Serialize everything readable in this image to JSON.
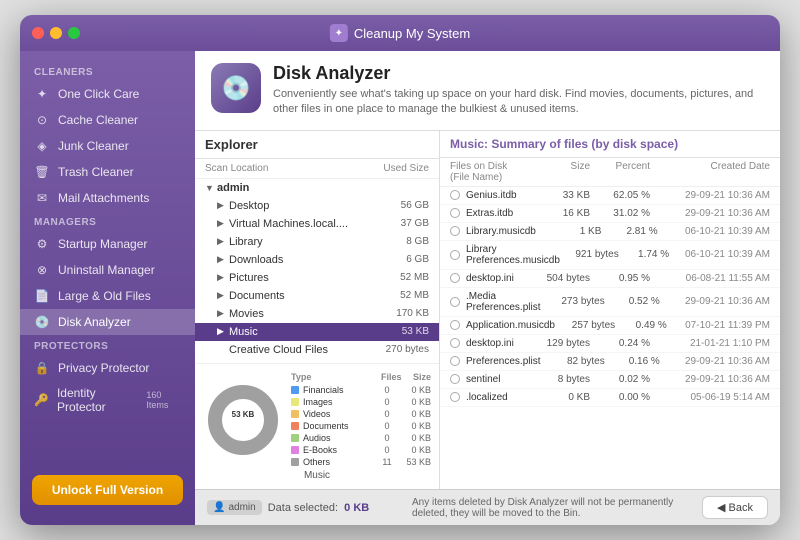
{
  "window": {
    "title": "Cleanup My System"
  },
  "sidebar": {
    "cleaners_label": "Cleaners",
    "managers_label": "Managers",
    "protectors_label": "Protectors",
    "items": {
      "one_click_care": "One Click Care",
      "cache_cleaner": "Cache Cleaner",
      "junk_cleaner": "Junk Cleaner",
      "trash_cleaner": "Trash Cleaner",
      "mail_attachments": "Mail Attachments",
      "startup_manager": "Startup Manager",
      "uninstall_manager": "Uninstall Manager",
      "large_old_files": "Large & Old Files",
      "disk_analyzer": "Disk Analyzer",
      "privacy_protector": "Privacy Protector",
      "identity_protector": "Identity Protector",
      "identity_protector_count": "160 Items"
    },
    "unlock_label": "Unlock Full Version"
  },
  "header": {
    "title": "Disk Analyzer",
    "description": "Conveniently see what's taking up space on your hard disk. Find movies, documents, pictures, and other files in one place to manage the bulkiest & unused items."
  },
  "explorer": {
    "title": "Explorer",
    "col_location": "Scan Location",
    "col_size": "Used Size",
    "tree": [
      {
        "name": "admin",
        "size": "",
        "level": 0,
        "arrow": "▼",
        "is_root": true
      },
      {
        "name": "Desktop",
        "size": "56 GB",
        "level": 1,
        "arrow": "▶"
      },
      {
        "name": "Virtual Machines.local....",
        "size": "37 GB",
        "level": 1,
        "arrow": "▶"
      },
      {
        "name": "Library",
        "size": "8 GB",
        "level": 1,
        "arrow": "▶"
      },
      {
        "name": "Downloads",
        "size": "6 GB",
        "level": 1,
        "arrow": "▶"
      },
      {
        "name": "Pictures",
        "size": "52 MB",
        "level": 1,
        "arrow": "▶"
      },
      {
        "name": "Documents",
        "size": "52 MB",
        "level": 1,
        "arrow": "▶"
      },
      {
        "name": "Movies",
        "size": "170 KB",
        "level": 1,
        "arrow": "▶"
      },
      {
        "name": "Music",
        "size": "53 KB",
        "level": 1,
        "arrow": "▶",
        "selected": true
      },
      {
        "name": "Creative Cloud Files",
        "size": "270 bytes",
        "level": 1,
        "arrow": ""
      }
    ]
  },
  "donut": {
    "center_label": "53 KB",
    "bottom_label": "Music",
    "legend": [
      {
        "name": "Financials",
        "color": "#4e9af1",
        "files": "0",
        "size": "0 KB"
      },
      {
        "name": "Images",
        "color": "#e8e87a",
        "files": "0",
        "size": "0 KB"
      },
      {
        "name": "Videos",
        "color": "#f0c060",
        "files": "0",
        "size": "0 KB"
      },
      {
        "name": "Documents",
        "color": "#f08060",
        "files": "0",
        "size": "0 KB"
      },
      {
        "name": "Audios",
        "color": "#a0d080",
        "files": "0",
        "size": "0 KB"
      },
      {
        "name": "E-Books",
        "color": "#e080e0",
        "files": "0",
        "size": "0 KB"
      },
      {
        "name": "Others",
        "color": "#a0a0a0",
        "files": "11",
        "size": "53 KB"
      }
    ],
    "col_type": "Type",
    "col_files": "Files",
    "col_size": "Size"
  },
  "files_panel": {
    "header": "Music: Summary of files (by disk space)",
    "col_name": "Files on Disk (File Name)",
    "col_size": "Size",
    "col_percent": "Percent",
    "col_date": "Created Date",
    "files": [
      {
        "name": "Genius.itdb",
        "size": "33 KB",
        "percent": "62.05 %",
        "date": "29-09-21 10:36 AM"
      },
      {
        "name": "Extras.itdb",
        "size": "16 KB",
        "percent": "31.02 %",
        "date": "29-09-21 10:36 AM"
      },
      {
        "name": "Library.musicdb",
        "size": "1 KB",
        "percent": "2.81 %",
        "date": "06-10-21 10:39 AM"
      },
      {
        "name": "Library Preferences.musicdb",
        "size": "921 bytes",
        "percent": "1.74 %",
        "date": "06-10-21 10:39 AM"
      },
      {
        "name": "desktop.ini",
        "size": "504 bytes",
        "percent": "0.95 %",
        "date": "06-08-21 11:55 AM"
      },
      {
        "name": ".Media Preferences.plist",
        "size": "273 bytes",
        "percent": "0.52 %",
        "date": "29-09-21 10:36 AM"
      },
      {
        "name": "Application.musicdb",
        "size": "257 bytes",
        "percent": "0.49 %",
        "date": "07-10-21 11:39 PM"
      },
      {
        "name": "desktop.ini",
        "size": "129 bytes",
        "percent": "0.24 %",
        "date": "21-01-21 1:10 PM"
      },
      {
        "name": "Preferences.plist",
        "size": "82 bytes",
        "percent": "0.16 %",
        "date": "29-09-21 10:36 AM"
      },
      {
        "name": "sentinel",
        "size": "8 bytes",
        "percent": "0.02 %",
        "date": "29-09-21 10:36 AM"
      },
      {
        "name": ".localized",
        "size": "0 KB",
        "percent": "0.00 %",
        "date": "05-06-19 5:14 AM"
      }
    ]
  },
  "bottom": {
    "admin_label": "admin",
    "data_selected_label": "Data selected:",
    "data_selected_value": "0 KB",
    "note": "Any items deleted by Disk Analyzer will not be permanently deleted, they will be moved to the Bin.",
    "back_label": "◀  Back"
  }
}
